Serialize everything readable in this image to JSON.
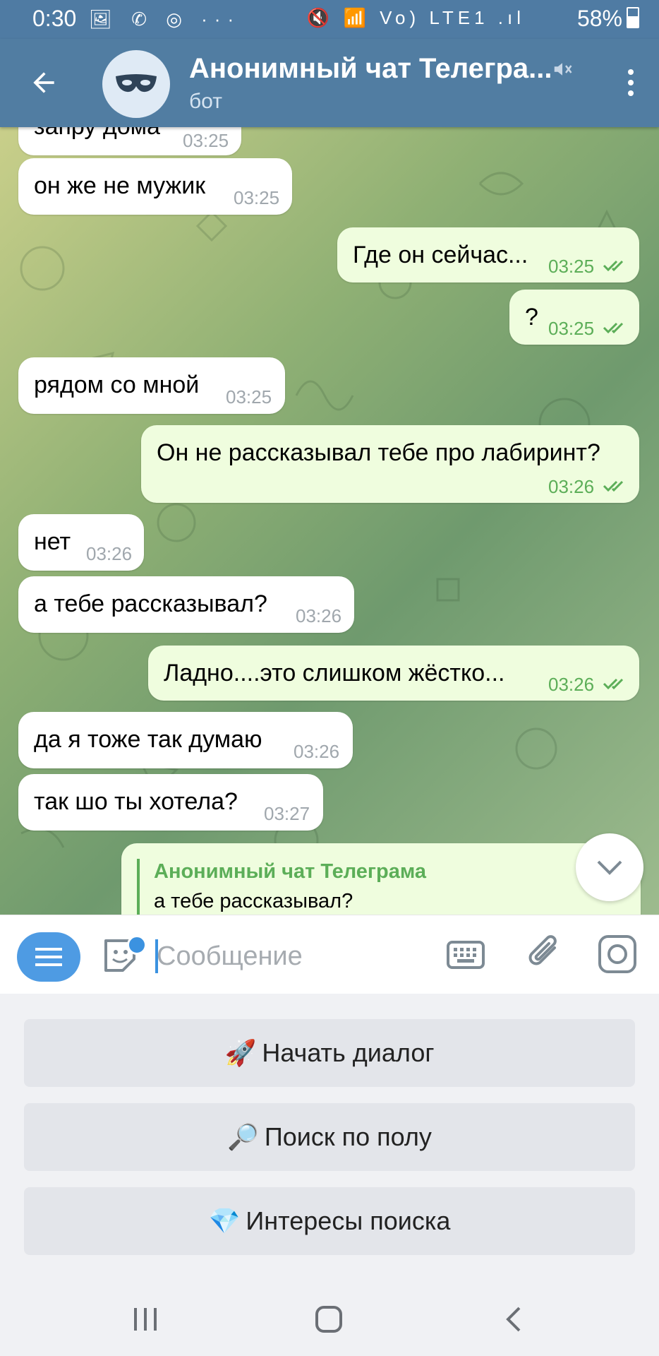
{
  "status_bar": {
    "time": "0:30",
    "left_icons": "🖼 ✆ ◎ ···",
    "right_icons": "🔇 📶 Vo) LTE1 .ıl",
    "battery": "58%"
  },
  "header": {
    "title": "Анонимный чат Телегра...",
    "subtitle": "бот"
  },
  "messages": [
    {
      "dir": "in",
      "text": "запру дома",
      "time": "03:25"
    },
    {
      "dir": "in",
      "text": "он же не мужик",
      "time": "03:25"
    },
    {
      "dir": "out",
      "text": "Где он сейчас...",
      "time": "03:25"
    },
    {
      "dir": "out",
      "text": "?",
      "time": "03:25"
    },
    {
      "dir": "in",
      "text": "рядом со мной",
      "time": "03:25"
    },
    {
      "dir": "out",
      "text": "Он не рассказывал тебе про лабиринт?",
      "time": "03:26"
    },
    {
      "dir": "in",
      "text": "нет",
      "time": "03:26"
    },
    {
      "dir": "in",
      "text": "а тебе рассказывал?",
      "time": "03:26"
    },
    {
      "dir": "out",
      "text": "Ладно....это слишком жёстко...",
      "time": "03:26"
    },
    {
      "dir": "in",
      "text": "да я тоже так думаю",
      "time": "03:26"
    },
    {
      "dir": "in",
      "text": "так шо ты хотела?",
      "time": "03:27"
    }
  ],
  "reply_preview": {
    "name": "Анонимный чат Телеграма",
    "text": "а тебе рассказывал?"
  },
  "input": {
    "placeholder": "Сообщение"
  },
  "keyboard_buttons": [
    {
      "emoji": "🚀",
      "label": "Начать диалог"
    },
    {
      "emoji": "🔎",
      "label": "Поиск по полу"
    },
    {
      "emoji": "💎",
      "label": "Интересы поиска"
    }
  ],
  "colors": {
    "header": "#517da2",
    "outgoing_bubble": "#effdde",
    "incoming_bubble": "#ffffff",
    "accent_green": "#5cae58",
    "accent_blue": "#4e9be3"
  }
}
